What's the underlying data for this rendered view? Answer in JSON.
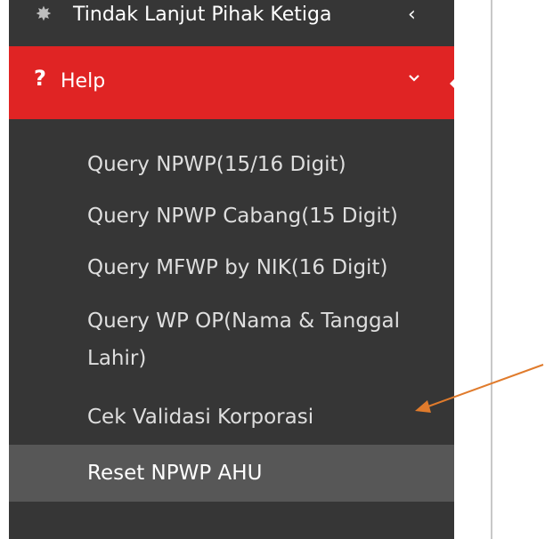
{
  "sidebar": {
    "prev_item": {
      "label": "Tindak Lanjut Pihak Ketiga",
      "icon": "gear-icon",
      "chevron": "‹"
    },
    "help": {
      "label": "Help",
      "icon": "question-icon",
      "icon_glyph": "?",
      "expanded": true,
      "accent_color": "#e02424"
    },
    "submenu": [
      {
        "label": "Query NPWP(15/16 Digit)",
        "active": false
      },
      {
        "label": "Query NPWP Cabang(15 Digit)",
        "active": false
      },
      {
        "label": "Query MFWP by NIK(16 Digit)",
        "active": false
      },
      {
        "label": "Query WP OP(Nama & Tanggal Lahir)",
        "active": false
      },
      {
        "label": "Cek Validasi Korporasi",
        "active": false
      },
      {
        "label": "Reset NPWP AHU",
        "active": true
      }
    ]
  },
  "annotation": {
    "arrow_color": "#e07b2c"
  }
}
